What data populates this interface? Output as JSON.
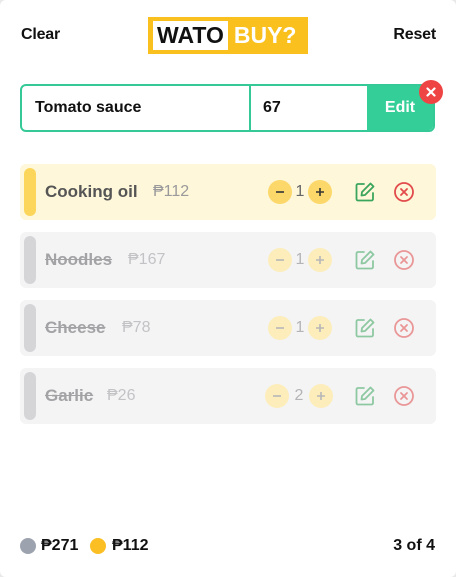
{
  "header": {
    "clear_label": "Clear",
    "reset_label": "Reset",
    "logo_part1": "WATO",
    "logo_part2": "BUY?"
  },
  "form": {
    "name_value": "Tomato sauce",
    "price_value": "67",
    "edit_label": "Edit"
  },
  "items": [
    {
      "name": "Cooking oil",
      "price": "₱112",
      "qty": "1",
      "status": "active"
    },
    {
      "name": "Noodles",
      "price": "₱167",
      "qty": "1",
      "status": "done"
    },
    {
      "name": "Cheese",
      "price": "₱78",
      "qty": "1",
      "status": "done"
    },
    {
      "name": "Garlic",
      "price": "₱26",
      "qty": "2",
      "status": "done"
    }
  ],
  "footer": {
    "done_total": "₱271",
    "remaining_total": "₱112",
    "count": "3 of 4"
  },
  "colors": {
    "accent_green": "#34c997",
    "accent_yellow": "#f9c01e",
    "danger_red": "#ef4444",
    "done_grey": "#9ca3af"
  }
}
